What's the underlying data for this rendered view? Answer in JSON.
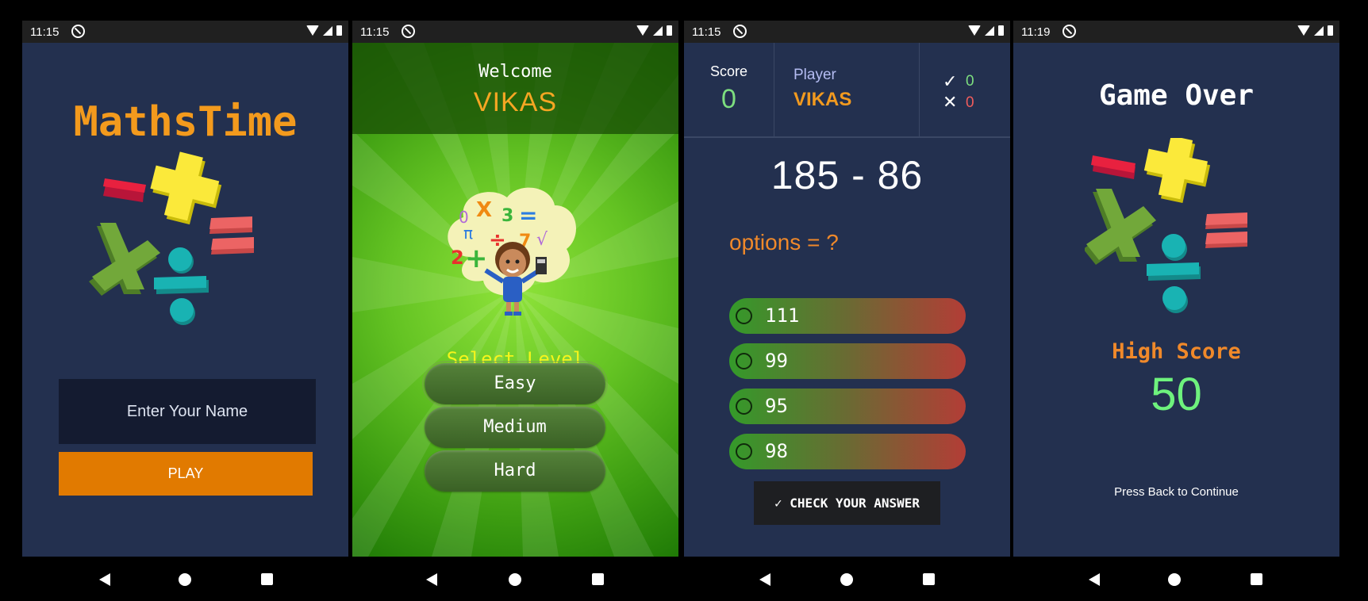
{
  "status_times": [
    "11:15",
    "11:15",
    "11:15",
    "11:19"
  ],
  "screen1": {
    "title": "MathsTime",
    "name_placeholder": "Enter Your Name",
    "play_label": "PLAY"
  },
  "screen2": {
    "welcome": "Welcome",
    "player_name": "VIKAS",
    "select_level": "Select Level",
    "levels": [
      "Easy",
      "Medium",
      "Hard"
    ],
    "illustration_digits": [
      "0",
      "X",
      "3",
      "=",
      "π",
      "÷",
      "7",
      "√",
      "2",
      "+"
    ]
  },
  "screen3": {
    "score_label": "Score",
    "score_value": "0",
    "player_label": "Player",
    "player_name": "VIKAS",
    "correct_count": "0",
    "wrong_count": "0",
    "question": "185 - 86",
    "options_label": "options = ?",
    "options": [
      "111",
      "99",
      "95",
      "98"
    ],
    "check_label": "CHECK YOUR ANSWER"
  },
  "screen4": {
    "title": "Game Over",
    "high_score_label": "High Score",
    "high_score_value": "50",
    "press_back": "Press Back to Continue"
  },
  "colors": {
    "navy": "#23304f",
    "orange": "#f39a1d",
    "green_score": "#7dde7f",
    "red_wrong": "#f05c5c"
  }
}
